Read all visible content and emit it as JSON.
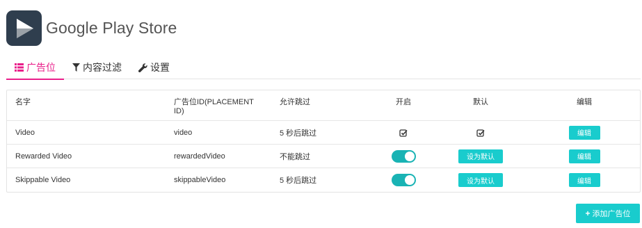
{
  "app": {
    "title": "Google Play Store",
    "icon": "play-store-icon"
  },
  "tabs": [
    {
      "label": "广告位",
      "icon": "list-icon",
      "active": true
    },
    {
      "label": "内容过滤",
      "icon": "filter-icon",
      "active": false
    },
    {
      "label": "设置",
      "icon": "wrench-icon",
      "active": false
    }
  ],
  "table": {
    "headers": {
      "name": "名字",
      "placement_id": "广告位ID(PLACEMENT ID)",
      "skip": "允许跳过",
      "enabled": "开启",
      "default": "默认",
      "edit": "编辑"
    },
    "rows": [
      {
        "name": "Video",
        "placement_id": "video",
        "skip": "5 秒后跳过",
        "enabled": "checkmark",
        "default": "checkmark",
        "edit_label": "编辑"
      },
      {
        "name": "Rewarded Video",
        "placement_id": "rewardedVideo",
        "skip": "不能跳过",
        "enabled": "toggle-on",
        "default_label": "设为默认",
        "edit_label": "编辑"
      },
      {
        "name": "Skippable Video",
        "placement_id": "skippableVideo",
        "skip": "5 秒后跳过",
        "enabled": "toggle-on",
        "default_label": "设为默认",
        "edit_label": "编辑"
      }
    ]
  },
  "add_button": {
    "label": "添加广告位",
    "icon": "plus-icon"
  },
  "colors": {
    "accent_tab": "#e91e8a",
    "button": "#19cccd",
    "toggle": "#19b3b4",
    "app_icon_bg": "#2f3e4e"
  }
}
